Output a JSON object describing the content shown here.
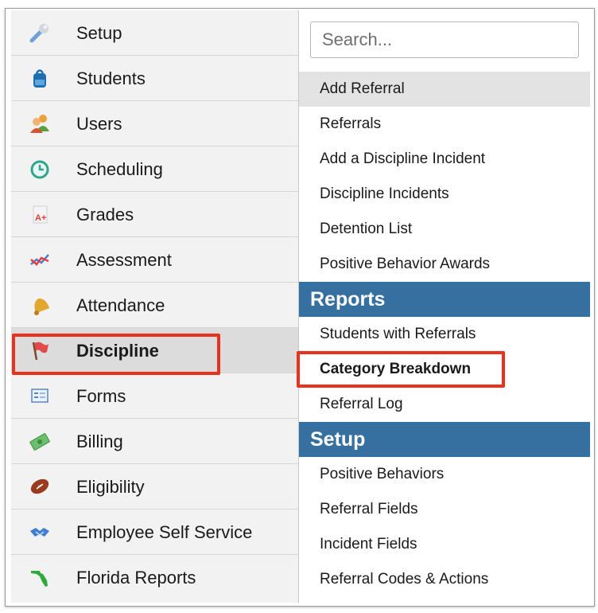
{
  "sidebar": {
    "items": [
      {
        "label": "Setup",
        "icon": "wrench-icon"
      },
      {
        "label": "Students",
        "icon": "backpack-icon"
      },
      {
        "label": "Users",
        "icon": "users-icon"
      },
      {
        "label": "Scheduling",
        "icon": "clock-icon"
      },
      {
        "label": "Grades",
        "icon": "grade-paper-icon"
      },
      {
        "label": "Assessment",
        "icon": "line-chart-icon"
      },
      {
        "label": "Attendance",
        "icon": "bell-icon"
      },
      {
        "label": "Discipline",
        "icon": "flag-icon",
        "active": true
      },
      {
        "label": "Forms",
        "icon": "form-icon"
      },
      {
        "label": "Billing",
        "icon": "money-icon"
      },
      {
        "label": "Eligibility",
        "icon": "football-icon"
      },
      {
        "label": "Employee Self Service",
        "icon": "handshake-icon"
      },
      {
        "label": "Florida Reports",
        "icon": "florida-icon"
      }
    ]
  },
  "menu": {
    "search_placeholder": "Search...",
    "items": [
      "Add Referral",
      "Referrals",
      "Add a Discipline Incident",
      "Discipline Incidents",
      "Detention List",
      "Positive Behavior Awards"
    ],
    "reports": {
      "header": "Reports",
      "items": [
        "Students with Referrals",
        "Category Breakdown",
        "Referral Log"
      ]
    },
    "setup": {
      "header": "Setup",
      "items": [
        "Positive Behaviors",
        "Referral Fields",
        "Incident Fields",
        "Referral Codes & Actions"
      ]
    }
  },
  "colors": {
    "section_header": "#3670a0",
    "highlight": "#e8311e",
    "sidebar_bg": "#f2f2f2"
  }
}
